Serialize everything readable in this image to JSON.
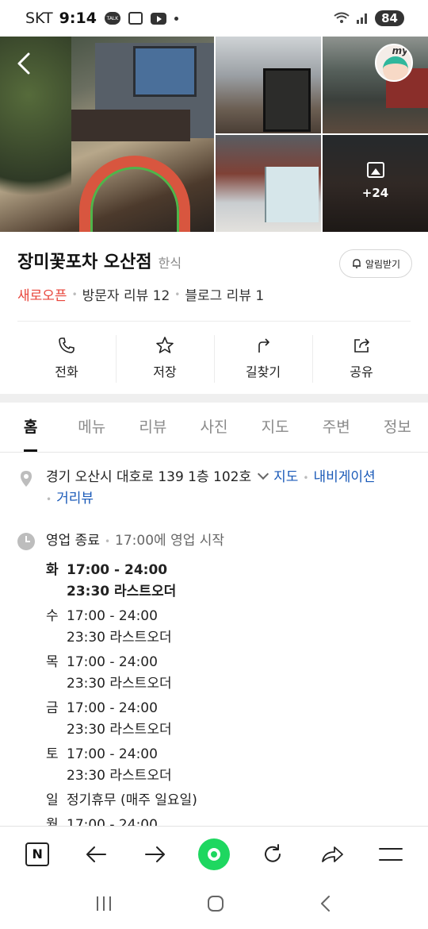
{
  "status_bar": {
    "carrier": "SKT",
    "time": "9:14",
    "talk_badge": "TALK",
    "battery": "84"
  },
  "photos": {
    "more_count": "+24"
  },
  "place": {
    "name": "장미꽃포차 오산점",
    "category": "한식",
    "notify_label": "알림받기",
    "new_open": "새로오픈",
    "visitor_reviews": "방문자 리뷰 12",
    "blog_reviews": "블로그 리뷰 1"
  },
  "actions": [
    {
      "label": "전화",
      "icon": "phone-icon"
    },
    {
      "label": "저장",
      "icon": "star-icon"
    },
    {
      "label": "길찾기",
      "icon": "directions-icon"
    },
    {
      "label": "공유",
      "icon": "share-icon"
    }
  ],
  "tabs": [
    {
      "label": "홈",
      "active": true
    },
    {
      "label": "메뉴"
    },
    {
      "label": "리뷰"
    },
    {
      "label": "사진"
    },
    {
      "label": "지도"
    },
    {
      "label": "주변"
    },
    {
      "label": "정보"
    }
  ],
  "info": {
    "address": "경기 오산시 대호로 139 1층 102호",
    "map_link": "지도",
    "nav_link": "내비게이션",
    "street_link": "거리뷰",
    "status": "영업 종료",
    "next_open": "17:00에 영업 시작",
    "hours": [
      {
        "day": "화",
        "time": "17:00 - 24:00",
        "note": "23:30 라스트오더",
        "today": true
      },
      {
        "day": "수",
        "time": "17:00 - 24:00",
        "note": "23:30 라스트오더"
      },
      {
        "day": "목",
        "time": "17:00 - 24:00",
        "note": "23:30 라스트오더"
      },
      {
        "day": "금",
        "time": "17:00 - 24:00",
        "note": "23:30 라스트오더"
      },
      {
        "day": "토",
        "time": "17:00 - 24:00",
        "note": "23:30 라스트오더"
      },
      {
        "day": "일",
        "time": "정기휴무 (매주 일요일)",
        "note": ""
      },
      {
        "day": "월",
        "time": "17:00 - 24:00",
        "note": ""
      }
    ]
  },
  "browser_bar": {
    "logo": "N"
  },
  "colors": {
    "new_open": "#e8443a",
    "link": "#1a5ab8",
    "green_button": "#1ed760"
  }
}
